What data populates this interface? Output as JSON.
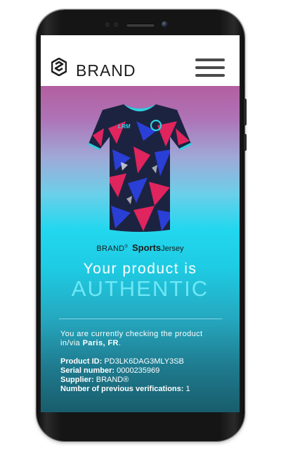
{
  "header": {
    "brand_name": "BRAND",
    "logo_icon": "brand-logo-icon",
    "menu_icon": "hamburger-menu-icon"
  },
  "product": {
    "brand": "BRAND",
    "brand_mark": "®",
    "name_bold": "Sports",
    "name_rest": "Jersey",
    "jersey_colors": {
      "base": "#1c2340",
      "accent_red": "#e0245e",
      "accent_blue": "#2a3fd6",
      "trim": "#2fd0e0"
    }
  },
  "verification": {
    "headline": "Your product is",
    "status": "AUTHENTIC",
    "checking_text": "You are currently checking the product in/via",
    "location": "Paris, FR",
    "location_suffix": "."
  },
  "details": {
    "product_id_label": "Product ID:",
    "product_id": "PD3LK6DAG3MLY3SB",
    "serial_label": "Serial number:",
    "serial": "0000235969",
    "supplier_label": "Supplier:",
    "supplier": "BRAND®",
    "verifications_label": "Number of previous verifications:",
    "verifications": "1"
  },
  "colors": {
    "gradient_top": "#b35fa0",
    "gradient_mid": "#22d7ef",
    "gradient_bottom": "#185d6c",
    "authentic_text": "#6ee7f6"
  }
}
